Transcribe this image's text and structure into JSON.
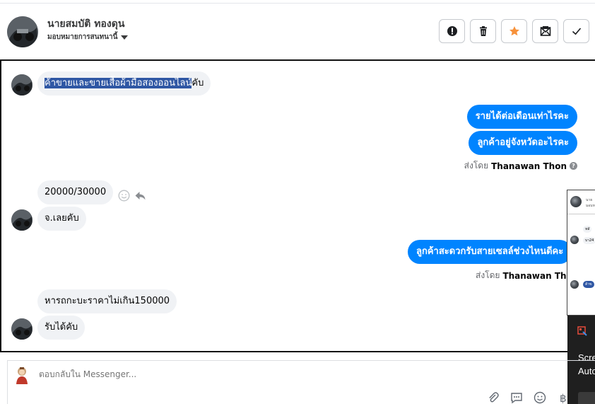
{
  "header": {
    "contact_name": "นายสมบัติ ทองดุน",
    "assign_label": "มอบหมายการสนทนานี้",
    "actions": [
      {
        "name": "spam-button",
        "icon": "alert-icon"
      },
      {
        "name": "delete-button",
        "icon": "trash-icon"
      },
      {
        "name": "star-button",
        "icon": "star-icon",
        "color": "#f7923b"
      },
      {
        "name": "mark-unread-button",
        "icon": "envelope-icon"
      },
      {
        "name": "done-button",
        "icon": "check-icon"
      }
    ]
  },
  "messages": {
    "m1_selected": "ค้าขายและขายเสื้อผ้ามือสองออนไลน์",
    "m1_rest": "คับ",
    "m2": "รายได้ต่อเดือนเท่าไรคะ",
    "m3": "ลูกค้าอยู่จังหวัดอะไรคะ",
    "sent_by_label": "ส่งโดย",
    "sent_by_name": "Thanawan Thon",
    "m4": "20000/30000",
    "m5": "จ.เลยคับ",
    "m6": "ลูกค้าสะดวกรับสายเซลล์ช่วงไหนดีคะ",
    "m7": "หารถกะบะราคาไม่เกิน150000",
    "m8": "รับได้คับ"
  },
  "mini_window": {
    "name": "นาย",
    "line2": "มอบห",
    "b1": "หลั",
    "b2": "บา24",
    "b3": "ค้าข"
  },
  "toast": {
    "title": "Scre",
    "subtitle": "Auto"
  },
  "composer": {
    "placeholder": "ตอบกลับใน Messenger..."
  },
  "colors": {
    "outgoing": "#0084ff",
    "incoming": "#f0f2f5",
    "selection": "#2f57a4",
    "star": "#f7923b"
  }
}
